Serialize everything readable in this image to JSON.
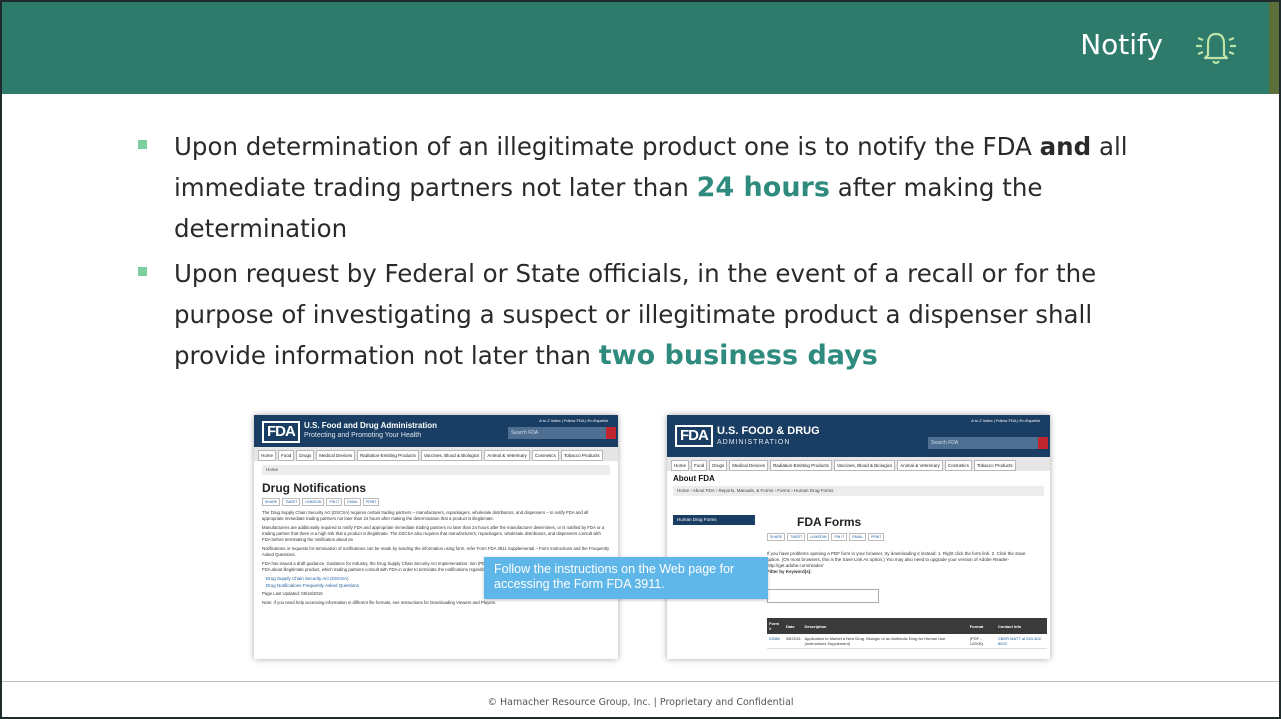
{
  "header": {
    "title": "Notify",
    "icon": "bell-icon",
    "color": "#2e7b6c"
  },
  "bullets": [
    {
      "part1": "Upon determination of an illegitimate product one is to notify the FDA ",
      "bold": "and",
      "part2": " all immediate trading partners not later than ",
      "highlight": "24 hours",
      "part3": " after making the determination"
    },
    {
      "part1": "Upon request by Federal or State officials, in the event of a recall or for the purpose of investigating a suspect or illegitimate product a dispenser shall provide information not later than ",
      "highlight": "two business days"
    }
  ],
  "screenshot1": {
    "logo": "FDA",
    "agency": "U.S. Food and Drug Administration",
    "tagline": "Protecting and Promoting Your Health",
    "top_links": "A to Z Index | Follow FDA | En Español",
    "search_placeholder": "Search FDA",
    "nav": [
      "Home",
      "Food",
      "Drugs",
      "Medical Devices",
      "Radiation-Emitting Products",
      "Vaccines, Blood & Biologics",
      "Animal & Veterinary",
      "Cosmetics",
      "Tobacco Products"
    ],
    "breadcrumb": "Home",
    "heading": "Drug Notifications",
    "share": [
      "SHARE",
      "TWEET",
      "LINKEDIN",
      "PIN IT",
      "EMAIL",
      "PRINT"
    ],
    "p1": "The Drug Supply Chain Security Act (DSCSA) requires certain trading partners – manufacturers, repackagers, wholesale distributors, and dispensers – to notify FDA and all appropriate immediate trading partners not later than 24 hours after making the determination that a product is illegitimate.",
    "p2": "Manufacturers are additionally required to notify FDA and appropriate immediate trading partners no later than 24 hours after the manufacturer determines, or is notified by FDA or a trading partner that there is a high risk that a product is illegitimate. The DSCSA also requires that manufacturers, repackagers, wholesale distributors, and dispensers consult with FDA before terminating the notification about an",
    "p3": "Notifications or requests for termination of notifications can be made by sending the information using form, refer Form FDA 3911 Supplemental – Form Instructions and the Frequently Asked Questions.",
    "p4": "FDA has issued a draft guidance, Guidance for Industry, the Drug Supply Chain Security Act Implementation: tion (PDF - 1.2MB), that addresses how trading partners should notify FDA about illegitimate product, which trading partners consult with FDA in order to terminate the notifications regarding illegitimate product.",
    "links": [
      "Drug Supply Chain Security Act (DSCSA)",
      "Drug Notifications Frequently Asked Questions"
    ],
    "updated": "Page Last Updated: 08/16/2016",
    "note": "Note: If you need help accessing information in different file formats, see Instructions for Downloading Viewers and Players."
  },
  "screenshot2": {
    "logo": "FDA",
    "agency": "U.S. FOOD & DRUG",
    "agency_sub": "ADMINISTRATION",
    "top_links": "A to Z Index | Follow FDA | En Español",
    "search_placeholder": "Search FDA",
    "nav": [
      "Home",
      "Food",
      "Drugs",
      "Medical Devices",
      "Radiation-Emitting Products",
      "Vaccines, Blood & Biologics",
      "Animal & Veterinary",
      "Cosmetics",
      "Tobacco Products"
    ],
    "section": "About FDA",
    "breadcrumb": "Home › About FDA › Reports, Manuals, & Forms › Forms › Human Drug Forms",
    "sidebar_item": "Human Drug Forms",
    "heading": "FDA Forms",
    "share": [
      "SHARE",
      "TWEET",
      "LINKEDIN",
      "PIN IT",
      "EMAIL",
      "PRINT"
    ],
    "instructions": "If you have problems opening a PDF form in your browser, try downloading it instead: 1. Right click the form link. 2. Click the Save option. (On most browsers, this is the Save Link As option.) You may also need to upgrade your version of Adobe Reader- http://get.adobe.com/reader/",
    "filter_label": "Filter by Keyword(s):",
    "table_headers": [
      "Form #",
      "Date",
      "Description",
      "Format",
      "Contact Info"
    ],
    "table_row": [
      "0356h",
      "08/2015",
      "Application to Market a New Drug, Biologic or an Antibiotic Drug for Human Use (Instructions Supplement)",
      "(PDF - 122KB)",
      "CBER MATT at 240-402-8020"
    ]
  },
  "tooltip": "Follow the instructions on the Web page for accessing the Form FDA 3911.",
  "footer": "© Hamacher Resource Group, Inc. | Proprietary and Confidential"
}
